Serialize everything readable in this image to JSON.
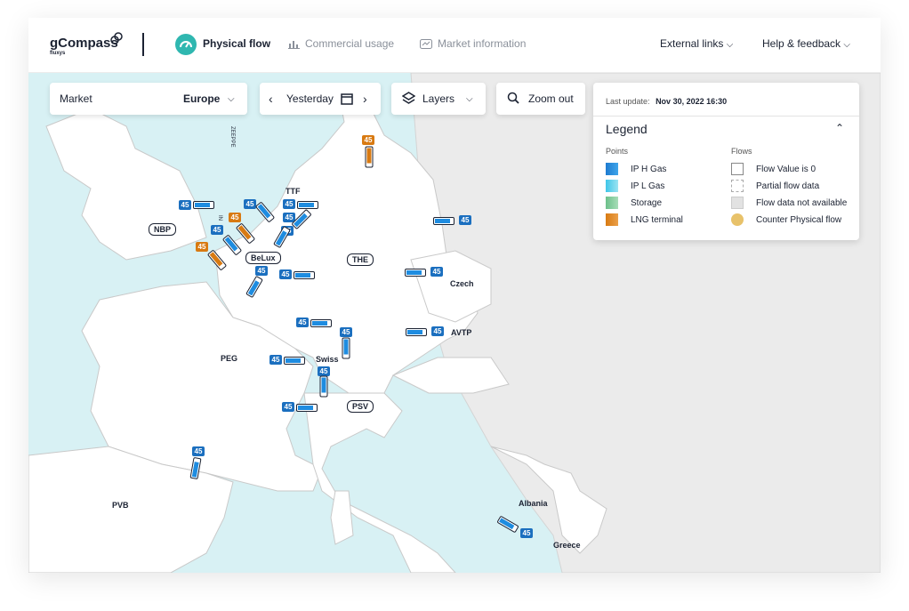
{
  "header": {
    "logo": "gCompass",
    "logo_sub": "fluxys",
    "nav": [
      {
        "label": "Physical flow",
        "active": true
      },
      {
        "label": "Commercial usage",
        "active": false
      },
      {
        "label": "Market information",
        "active": false
      }
    ],
    "external_links": "External links",
    "help": "Help & feedback"
  },
  "controls": {
    "market_label": "Market",
    "market_value": "Europe",
    "date_value": "Yesterday",
    "layers_label": "Layers",
    "zoom_label": "Zoom out"
  },
  "legend": {
    "last_update_label": "Last update:",
    "last_update_value": "Nov 30, 2022 16:30",
    "title": "Legend",
    "points_title": "Points",
    "flows_title": "Flows",
    "points": [
      {
        "label": "IP H Gas",
        "color": "#1e7bd0"
      },
      {
        "label": "IP L Gas",
        "color": "#3fc6e8"
      },
      {
        "label": "Storage",
        "color": "#6cc08a"
      },
      {
        "label": "LNG terminal",
        "color": "#d87a12"
      }
    ],
    "flows": [
      {
        "label": "Flow Value is 0"
      },
      {
        "label": "Partial flow data"
      },
      {
        "label": "Flow data not available"
      },
      {
        "label": "Counter Physical flow"
      }
    ]
  },
  "zones": {
    "nbp": "NBP",
    "ttf": "TTF",
    "belux": "BeLux",
    "the": "THE",
    "czech": "Czech",
    "avtp": "AVTP",
    "peg": "PEG",
    "swiss": "Swiss",
    "psv": "PSV",
    "pvb": "PVB",
    "albania": "Albania",
    "greece": "Greece",
    "zeeppe": "ZEEPPE",
    "in": "IN"
  },
  "flow_value": "45",
  "colors": {
    "accent": "#2fb7b0",
    "sea": "#d8f1f4",
    "land_flux": "#ffffff",
    "land_other": "#ebebeb",
    "badge": "#1b6fbf",
    "lng": "#d87a12"
  }
}
